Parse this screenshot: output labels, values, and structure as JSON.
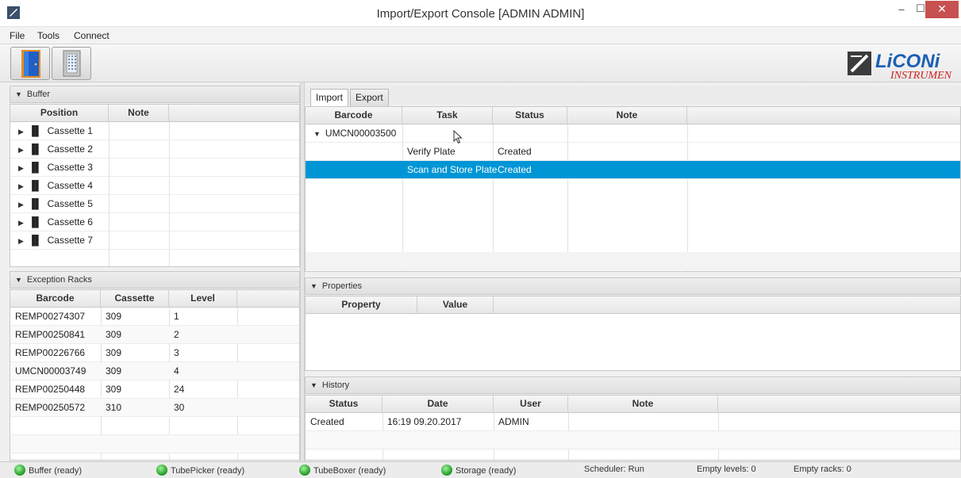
{
  "window": {
    "title": "Import/Export Console [ADMIN ADMIN]",
    "min_glyph": "–",
    "max_glyph": "☐",
    "close_glyph": "✕"
  },
  "menu": [
    "File",
    "Tools",
    "Connect"
  ],
  "toolbar": {
    "buttons": [
      "door-icon",
      "storage-rack-icon"
    ],
    "logo_text_1": "LiCONi",
    "logo_text_2": "INSTRUMEN"
  },
  "buffer": {
    "header": "Buffer",
    "columns": [
      "Position",
      "Note"
    ],
    "rows": [
      "Cassette 1",
      "Cassette 2",
      "Cassette 3",
      "Cassette 4",
      "Cassette 5",
      "Cassette 6",
      "Cassette 7"
    ]
  },
  "exception_racks": {
    "header": "Exception Racks",
    "columns": [
      "Barcode",
      "Cassette",
      "Level"
    ],
    "rows": [
      {
        "barcode": "REMP00274307",
        "cassette": "309",
        "level": "1"
      },
      {
        "barcode": "REMP00250841",
        "cassette": "309",
        "level": "2"
      },
      {
        "barcode": "REMP00226766",
        "cassette": "309",
        "level": "3"
      },
      {
        "barcode": "UMCN00003749",
        "cassette": "309",
        "level": "4"
      },
      {
        "barcode": "REMP00250448",
        "cassette": "309",
        "level": "24"
      },
      {
        "barcode": "REMP00250572",
        "cassette": "310",
        "level": "30"
      }
    ]
  },
  "tabs": [
    "Import",
    "Export"
  ],
  "import": {
    "columns": [
      "Barcode",
      "Task",
      "Status",
      "Note"
    ],
    "group": "UMCN00003500",
    "rows": [
      {
        "task": "Verify Plate",
        "status": "Created"
      },
      {
        "task": "Scan and Store Plate",
        "status": "Created"
      }
    ]
  },
  "properties": {
    "header": "Properties",
    "columns": [
      "Property",
      "Value"
    ]
  },
  "history": {
    "header": "History",
    "columns": [
      "Status",
      "Date",
      "User",
      "Note"
    ],
    "rows": [
      {
        "status": "Created",
        "date": "16:19 09.20.2017",
        "user": "ADMIN"
      }
    ]
  },
  "status": {
    "buffer": "Buffer (ready)",
    "tubepicker": "TubePicker (ready)",
    "tubeboxer": "TubeBoxer (ready)",
    "storage": "Storage (ready)",
    "scheduler": "Scheduler: Run",
    "empty_levels": "Empty levels: 0",
    "empty_racks": "Empty racks: 0"
  },
  "colors": {
    "selection": "#0096d6",
    "close_button": "#c75050",
    "status_led": "#2ea52e"
  }
}
